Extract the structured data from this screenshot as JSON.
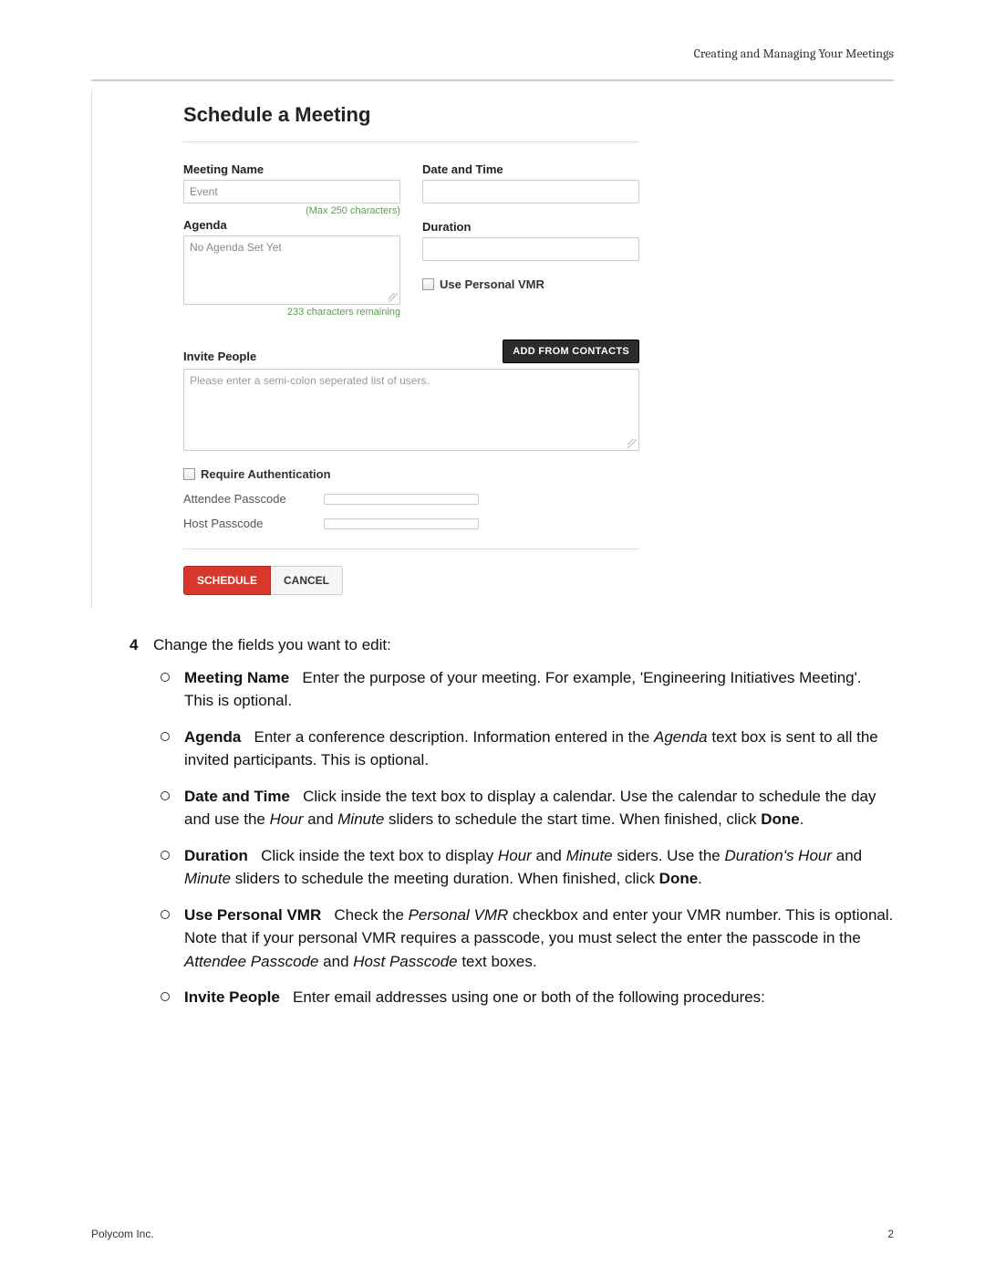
{
  "header": {
    "running_title": "Creating and Managing Your Meetings"
  },
  "app": {
    "title": "Schedule a Meeting",
    "meeting_name_label": "Meeting Name",
    "meeting_name_value": "Event",
    "meeting_name_hint": "(Max 250 characters)",
    "agenda_label": "Agenda",
    "agenda_value": "No Agenda Set Yet",
    "agenda_hint": "233 characters remaining",
    "date_time_label": "Date and Time",
    "duration_label": "Duration",
    "use_personal_vmr_label": "Use Personal VMR",
    "invite_label": "Invite People",
    "add_from_contacts_btn": "ADD FROM CONTACTS",
    "invite_placeholder": "Please enter a semi-colon seperated list of users.",
    "require_auth_label": "Require Authentication",
    "attendee_passcode_label": "Attendee Passcode",
    "host_passcode_label": "Host Passcode",
    "schedule_btn": "SCHEDULE",
    "cancel_btn": "CANCEL"
  },
  "instructions": {
    "step_number": "4",
    "step_text": "Change the fields you want to edit:",
    "items": {
      "meeting_name": {
        "term": "Meeting Name",
        "desc_1": "Enter the purpose of your meeting. For example, 'Engineering Initiatives Meeting'. This is optional."
      },
      "agenda": {
        "term": "Agenda",
        "desc_1": "Enter a conference description. Information entered in the ",
        "ital_1": "Agenda",
        "desc_2": " text box is sent to all the invited participants. This is optional."
      },
      "date_time": {
        "term": "Date and Time",
        "desc_1": "Click inside the text box to display a calendar. Use the calendar to schedule the day and use the ",
        "ital_1": "Hour",
        "desc_2": " and ",
        "ital_2": "Minute",
        "desc_3": " sliders to schedule the start time. When finished, click ",
        "bold_1": "Done",
        "desc_4": "."
      },
      "duration": {
        "term": "Duration",
        "desc_1": "Click inside the text box to display ",
        "ital_1": "Hour",
        "desc_2": " and ",
        "ital_2": "Minute",
        "desc_3": " siders. Use the ",
        "ital_3": "Duration's Hour",
        "desc_4": " and ",
        "ital_4": "Minute",
        "desc_5": " sliders to schedule the meeting duration. When finished, click ",
        "bold_1": "Done",
        "desc_6": "."
      },
      "vmr": {
        "term": "Use Personal VMR",
        "desc_1": "Check the ",
        "ital_1": "Personal VMR",
        "desc_2": " checkbox and enter your VMR number. This is optional. Note that if your personal VMR requires a passcode, you must select the enter the passcode in the ",
        "ital_2": "Attendee Passcode",
        "desc_3": " and ",
        "ital_3": "Host Passcode",
        "desc_4": " text boxes."
      },
      "invite": {
        "term": "Invite People",
        "desc_1": "Enter email addresses using one or both of the following procedures:"
      }
    }
  },
  "footer": {
    "company": "Polycom Inc.",
    "page_number": "2"
  }
}
